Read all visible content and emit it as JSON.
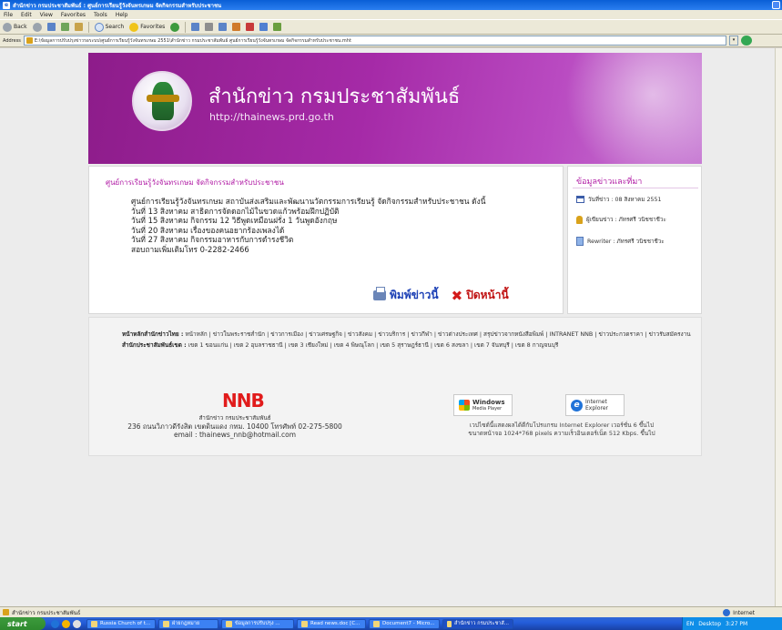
{
  "window": {
    "title": "สำนักข่าว กรมประชาสัมพันธ์ : ศูนย์การเรียนรู้วังจันทรเกษม จัดกิจกรรมสำหรับประชาชน"
  },
  "menu": [
    "File",
    "Edit",
    "View",
    "Favorites",
    "Tools",
    "Help"
  ],
  "toolbar": {
    "back": "Back",
    "search": "Search",
    "favorites": "Favorites"
  },
  "address": {
    "label": "Address",
    "value": "E:\\ข้อมูลการปรับปรุงข่าวรอระบบ\\ศูนย์การเรียนรู้วังจันทรเกษม 2551\\สำนักข่าว กรมประชาสัมพันธ์ ศูนย์การเรียนรู้วังจันทรเกษม จัดกิจกรรมสำหรับประชาชน.mht"
  },
  "banner": {
    "title": "สำนักข่าว กรมประชาสัมพันธ์",
    "url": "http://thainews.prd.go.th"
  },
  "article": {
    "title": "ศูนย์การเรียนรู้วังจันทรเกษม จัดกิจกรรมสำหรับประชาชน",
    "intro": "ศูนย์การเรียนรู้วังจันทรเกษม สถาบันส่งเสริมและพัฒนานวัตกรรมการเรียนรู้ จัดกิจกรรมสำหรับประชาชน ดังนี้",
    "lines": [
      "วันที่ 13 สิงหาคม สาธิตการจัดดอกไม้ในขวดแก้วพร้อมฝึกปฏิบัติ",
      "วันที่ 15 สิงหาคม กิจกรรม 12 วิธีพูดเหมือนฝรั่ง 1 วันพูดอังกฤษ",
      "วันที่ 20 สิงหาคม เรื่องของคนอยากร้องเพลงได้",
      "วันที่ 27 สิงหาคม กิจกรรมอาหารกับการดำรงชีวิต",
      "สอบถามเพิ่มเติมโทร 0-2282-2466"
    ],
    "print_label": "พิมพ์ข่าวนี้",
    "close_label": "ปิดหน้านี้"
  },
  "sidebar": {
    "title": "ข้อมูลข่าวและที่มา",
    "date": "วันที่ข่าว : 08 สิงหาคม 2551",
    "author": "ผู้เขียนข่าว : ภัทรศรี วนิชชาชีวะ",
    "rewriter": "Rewriter : ภัทรศรี วนิชชาชีวะ"
  },
  "footer": {
    "nav_label": "หน้าหลักสำนักข่าวไทย :",
    "nav_links": "หน้าหลัก | ข่าวในพระราชสำนัก | ข่าวการเมือง | ข่าวเศรษฐกิจ | ข่าวสังคม | ข่าวบริการ | ข่าวกีฬา | ข่าวต่างประเทศ | สรุปข่าวจากหนังสือพิมพ์ | INTRANET NNB | ข่าวประกวดราคา | ข่าวรับสมัครงาน",
    "regions_label": "สำนักประชาสัมพันธ์เขต :",
    "regions_links": "เขต 1 ขอนแก่น | เขต 2 อุบลราชธานี | เขต 3 เชียงใหม่ | เขต 4 พิษณุโลก | เขต 5 สุราษฎร์ธานี | เขต 6 สงขลา | เขต 7 จันทบุรี | เขต 8 กาญจนบุรี",
    "logo": "NNB",
    "org": "สำนักข่าว กรมประชาสัมพันธ์",
    "address": "236 ถนนวิภาวดีรังสิต เขตดินแดง กทม. 10400 โทรศัพท์ 02-275-5800",
    "email": "email : thainews_nnb@hotmail.com",
    "badge_wmp": [
      "Windows",
      "Media Player"
    ],
    "badge_ie": [
      "Internet",
      "Explorer"
    ],
    "compat_1": "เวปไซต์นี้แสดงผลได้ดีกับโปรแกรม Internet Explorer เวอร์ชั่น 6 ขึ้นไป",
    "compat_2": "ขนาดหน้าจอ 1024*768 pixels ความเร็วอินเตอร์เน็ต 512 Kbps. ขึ้นไป"
  },
  "status": {
    "text": "สำนักข่าว กรมประชาสัมพันธ์",
    "zone": "Internet"
  },
  "taskbar": {
    "start": "start",
    "tasks": [
      "Russia Church of t...",
      "ฝ่ายกฎหมาย",
      "ข้อมูลการปรับปรุง ...",
      "Read news.doc [C...",
      "Document7 - Micro...",
      "สำนักข่าว กรมประชาสั..."
    ],
    "lang": "EN",
    "desktop": "Desktop",
    "clock": "3:27 PM"
  },
  "colors": {
    "accent": "#b01aa4",
    "banner": "#a52aa7",
    "logo_red": "#e11b1b",
    "link_blue": "#1b3fb5"
  }
}
